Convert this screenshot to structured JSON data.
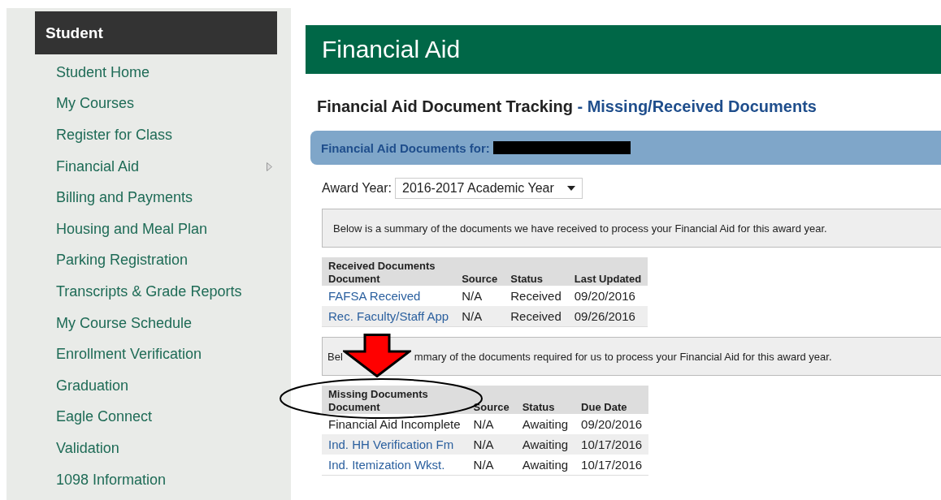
{
  "sidebar": {
    "heading": "Student",
    "items": [
      {
        "label": "Student Home",
        "has_submenu": false
      },
      {
        "label": "My Courses",
        "has_submenu": false
      },
      {
        "label": "Register for Class",
        "has_submenu": false
      },
      {
        "label": "Financial Aid",
        "has_submenu": true
      },
      {
        "label": "Billing and Payments",
        "has_submenu": false
      },
      {
        "label": "Housing and Meal Plan",
        "has_submenu": false
      },
      {
        "label": "Parking Registration",
        "has_submenu": false
      },
      {
        "label": "Transcripts & Grade Reports",
        "has_submenu": false
      },
      {
        "label": "My Course Schedule",
        "has_submenu": false
      },
      {
        "label": "Enrollment Verification",
        "has_submenu": false
      },
      {
        "label": "Graduation",
        "has_submenu": false
      },
      {
        "label": "Eagle Connect",
        "has_submenu": false
      },
      {
        "label": "Validation",
        "has_submenu": false
      },
      {
        "label": "1098 Information",
        "has_submenu": false
      }
    ]
  },
  "page_title": "Financial Aid",
  "section_title": {
    "main": "Financial Aid Document Tracking",
    "sub": "- Missing/Received Documents"
  },
  "documents_bar": {
    "label": "Financial Aid Documents for:",
    "redacted": true
  },
  "award_year": {
    "label": "Award Year:",
    "value": "2016-2017 Academic Year"
  },
  "received": {
    "summary": [
      "Below is a summary of the documents we have received to process your Financial Aid for this award year."
    ],
    "table": {
      "caption": "Received Documents",
      "columns": [
        "Document",
        "Source",
        "Status",
        "Last Updated"
      ],
      "rows": [
        {
          "document": "FAFSA Received",
          "link": true,
          "source": "N/A",
          "status": "Received",
          "date": "09/20/2016"
        },
        {
          "document": "Rec. Faculty/Staff App",
          "link": true,
          "source": "N/A",
          "status": "Received",
          "date": "09/26/2016"
        }
      ]
    }
  },
  "missing": {
    "summary": [
      "Bel",
      "mmary of the documents required for us to process your Financial Aid for this award year."
    ],
    "table": {
      "caption": "Missing Documents",
      "columns": [
        "Document",
        "Source",
        "Status",
        "Due Date"
      ],
      "rows": [
        {
          "document": "Financial Aid Incomplete",
          "link": false,
          "source": "N/A",
          "status": "Awaiting",
          "date": "09/20/2016"
        },
        {
          "document": "Ind. HH Verification Fm",
          "link": true,
          "source": "N/A",
          "status": "Awaiting",
          "date": "10/17/2016"
        },
        {
          "document": "Ind. Itemization Wkst.",
          "link": true,
          "source": "N/A",
          "status": "Awaiting",
          "date": "10/17/2016"
        }
      ]
    }
  }
}
